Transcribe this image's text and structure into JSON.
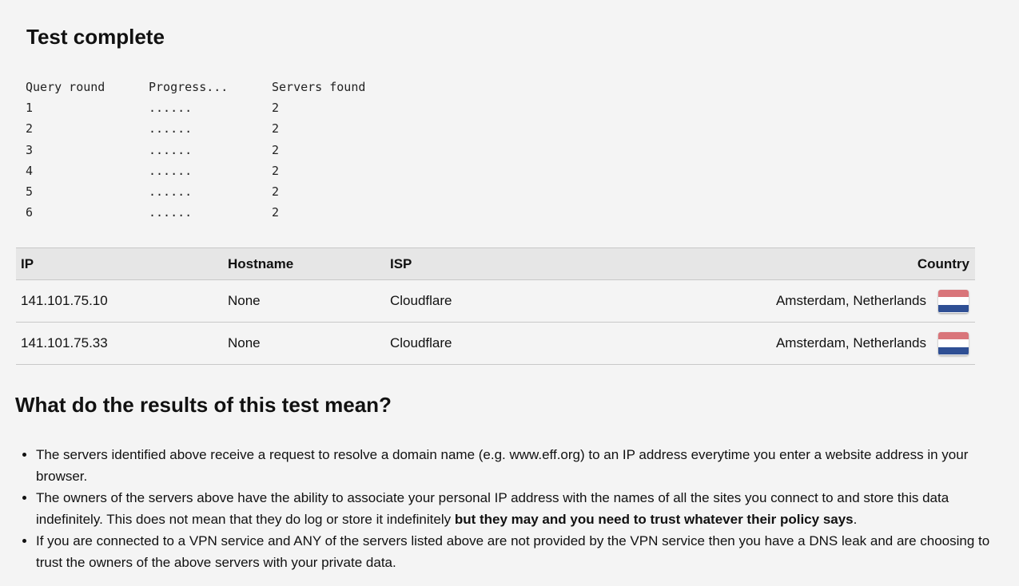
{
  "page": {
    "title": "Test complete"
  },
  "query_table": {
    "headers": [
      "Query round",
      "Progress...",
      "Servers found"
    ],
    "rows": [
      {
        "round": "1",
        "progress": "......",
        "found": "2"
      },
      {
        "round": "2",
        "progress": "......",
        "found": "2"
      },
      {
        "round": "3",
        "progress": "......",
        "found": "2"
      },
      {
        "round": "4",
        "progress": "......",
        "found": "2"
      },
      {
        "round": "5",
        "progress": "......",
        "found": "2"
      },
      {
        "round": "6",
        "progress": "......",
        "found": "2"
      }
    ]
  },
  "server_table": {
    "headers": {
      "ip": "IP",
      "hostname": "Hostname",
      "isp": "ISP",
      "country": "Country"
    },
    "rows": [
      {
        "ip": "141.101.75.10",
        "hostname": "None",
        "isp": "Cloudflare",
        "country": "Amsterdam, Netherlands",
        "flag_icon": "netherlands-flag-icon"
      },
      {
        "ip": "141.101.75.33",
        "hostname": "None",
        "isp": "Cloudflare",
        "country": "Amsterdam, Netherlands",
        "flag_icon": "netherlands-flag-icon"
      }
    ]
  },
  "flag_colors": {
    "red": "#d9757a",
    "white": "#ffffff",
    "blue": "#2f4f94"
  },
  "explanation": {
    "heading": "What do the results of this test mean?",
    "items": [
      {
        "text": "The servers identified above receive a request to resolve a domain name (e.g. www.eff.org) to an IP address everytime you enter a website address in your browser."
      },
      {
        "text": "The owners of the servers above have the ability to associate your personal IP address with the names of all the sites you connect to and store this data indefinitely. This does not mean that they do log or store it indefinitely ",
        "bold": "but they may and you need to trust whatever their policy says",
        "after": "."
      },
      {
        "text": "If you are connected to a VPN service and ANY of the servers listed above are not provided by the VPN service then you have a DNS leak and are choosing to trust the owners of the above servers with your private data."
      }
    ]
  }
}
